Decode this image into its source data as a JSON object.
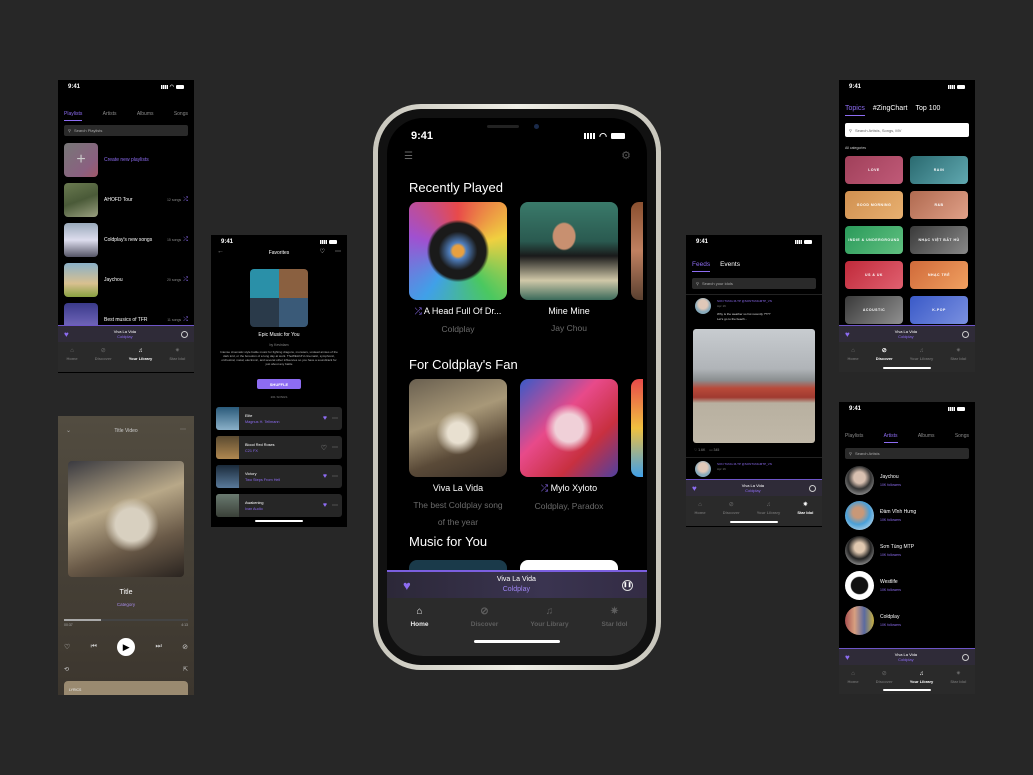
{
  "status_time": "9:41",
  "colors": {
    "accent": "#8d6cf2",
    "background": "#272727",
    "screen": "#000000"
  },
  "now_playing": {
    "title": "Viva La Vida",
    "artist": "Coldplay"
  },
  "nav": [
    {
      "label": "Home",
      "icon": "home-icon"
    },
    {
      "label": "Discover",
      "icon": "compass-icon"
    },
    {
      "label": "Your Library",
      "icon": "music-note-icon"
    },
    {
      "label": "Star Idol",
      "icon": "star-icon"
    }
  ],
  "library_playlists": {
    "tabs": [
      "Playlists",
      "Artists",
      "Albums",
      "Songs"
    ],
    "active_tab": "Playlists",
    "search_placeholder": "Search Playlists",
    "create_label": "Create new playlists",
    "playlists": [
      {
        "name": "AHOFD Tour",
        "count": "12 songs"
      },
      {
        "name": "Coldplay's new songs",
        "count": "15 songs"
      },
      {
        "name": "Jaychou",
        "count": "20 songs"
      },
      {
        "name": "Best musics of TFR",
        "count": "11 songs"
      }
    ],
    "active_nav": "Your Library"
  },
  "player": {
    "header": "Title Video",
    "title": "Title",
    "category": "Category",
    "elapsed": "00:37",
    "duration": "4:13",
    "progress": 0.3,
    "lyrics_label": "LYRICS"
  },
  "favorites": {
    "header": "Favorites",
    "title": "Epic Music for You",
    "author": "by Kevinlam",
    "description": "Intense cinematic style battle music for fighting dragons, monsters, undead armies of the dark lord, or the boredom of a long day at work. TheWELKZ'd cinematic, symphonic, orchestral, metal, electronic, and several other influences so you have a soundtrack for just about any battle",
    "shuffle_label": "SHUFFLE",
    "songs_count": "201 SONGS",
    "songs": [
      {
        "title": "Elite",
        "artist": "Magnus H. Tellmann",
        "liked": true
      },
      {
        "title": "Blood Red Roses",
        "artist": "C21 FX",
        "liked": false
      },
      {
        "title": "Victory",
        "artist": "Two Steps From Hell",
        "liked": true
      },
      {
        "title": "Awakening",
        "artist": "Ivan Audio",
        "liked": true
      }
    ]
  },
  "home": {
    "recently_played_title": "Recently Played",
    "recently_played": [
      {
        "title": "A Head Full Of Dr...",
        "subtitle": "Coldplay",
        "shuffle": true
      },
      {
        "title": "Mine Mine",
        "subtitle": "Jay Chou",
        "shuffle": false
      }
    ],
    "fan_title": "For Coldplay's Fan",
    "fan_items": [
      {
        "title": "Viva La Vida",
        "subtitle": "The best Coldplay song of the year",
        "shuffle": false
      },
      {
        "title": "Mylo Xyloto",
        "subtitle": "Coldplay, Paradox",
        "shuffle": true
      }
    ],
    "music_for_you_title": "Music for You",
    "active_nav": "Home"
  },
  "feeds": {
    "tabs": [
      "Feeds",
      "Events"
    ],
    "active_tab": "Feeds",
    "search_placeholder": "Search your idols",
    "posts": [
      {
        "author": "SON TUNG M-TP @SONTUNGMTP_VN",
        "date": "Apr 16",
        "text_line1": "Why is the weather so hot recently ????",
        "text_line2": "Let's go to the beach...",
        "likes": "1.6K",
        "comments": "345"
      },
      {
        "author": "SON TUNG M-TP @SONTUNGMTP_VN",
        "date": "Apr 16"
      }
    ],
    "active_nav": "Star Idol"
  },
  "discover": {
    "tabs": [
      "Topics",
      "#ZingChart",
      "Top 100"
    ],
    "active_tab": "Topics",
    "search_placeholder": "Search Artists, Songs, MV",
    "categories_label": "All categories",
    "categories": [
      "LOVE",
      "RAIN",
      "GOOD MORNING",
      "R&B",
      "INDIE & UNDERGROUND",
      "NHẠC VIỆT BẤT HỦ",
      "US & UK",
      "NHẠC TRẺ",
      "ACOUSTIC",
      "K-POP"
    ],
    "active_nav": "Discover"
  },
  "library_artists": {
    "tabs": [
      "Playlists",
      "Artists",
      "Albums",
      "Songs"
    ],
    "active_tab": "Artists",
    "search_placeholder": "Search Artists",
    "artists": [
      {
        "name": "Jaychou",
        "followers": "10K followers"
      },
      {
        "name": "Đàm Vĩnh Hưng",
        "followers": "10K followers"
      },
      {
        "name": "Sơn Tùng MTP",
        "followers": "10K followers"
      },
      {
        "name": "Westlife",
        "followers": "10K followers"
      },
      {
        "name": "Coldplay",
        "followers": "10K followers"
      }
    ],
    "active_nav": "Your Library"
  }
}
